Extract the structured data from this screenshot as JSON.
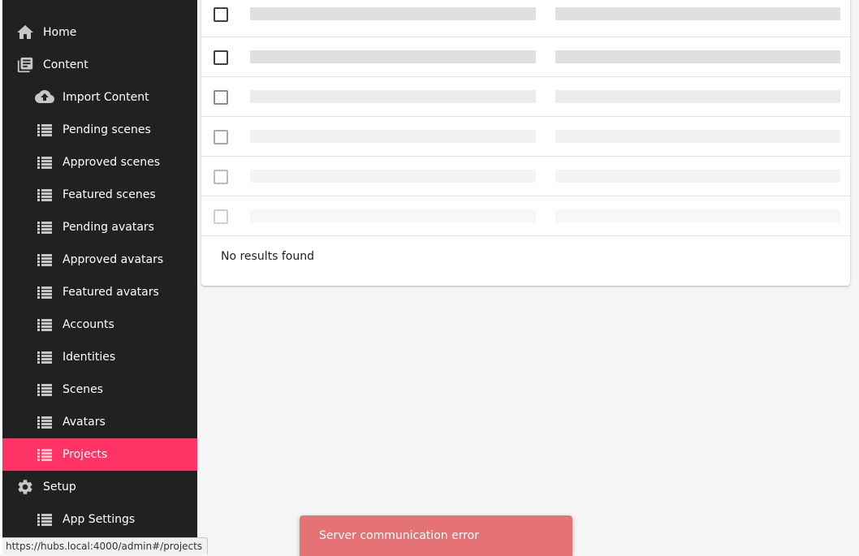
{
  "colors": {
    "sidebar_bg": "#212121",
    "active_bg": "#ff3464",
    "snackbar_bg": "#e57373",
    "skeleton": "#e0e0e0",
    "page_bg": "#f5f5f5"
  },
  "sidebar": {
    "items": [
      {
        "label": "Home",
        "icon": "home-icon",
        "level": "top",
        "active": false
      },
      {
        "label": "Content",
        "icon": "library-books-icon",
        "level": "top",
        "active": false
      },
      {
        "label": "Import Content",
        "icon": "cloud-upload-icon",
        "level": "sub",
        "active": false
      },
      {
        "label": "Pending scenes",
        "icon": "list-icon",
        "level": "sub",
        "active": false
      },
      {
        "label": "Approved scenes",
        "icon": "list-icon",
        "level": "sub",
        "active": false
      },
      {
        "label": "Featured scenes",
        "icon": "list-icon",
        "level": "sub",
        "active": false
      },
      {
        "label": "Pending avatars",
        "icon": "list-icon",
        "level": "sub",
        "active": false
      },
      {
        "label": "Approved avatars",
        "icon": "list-icon",
        "level": "sub",
        "active": false
      },
      {
        "label": "Featured avatars",
        "icon": "list-icon",
        "level": "sub",
        "active": false
      },
      {
        "label": "Accounts",
        "icon": "list-icon",
        "level": "sub",
        "active": false
      },
      {
        "label": "Identities",
        "icon": "list-icon",
        "level": "sub",
        "active": false
      },
      {
        "label": "Scenes",
        "icon": "list-icon",
        "level": "sub",
        "active": false
      },
      {
        "label": "Avatars",
        "icon": "list-icon",
        "level": "sub",
        "active": false
      },
      {
        "label": "Projects",
        "icon": "list-icon",
        "level": "sub",
        "active": true
      },
      {
        "label": "Setup",
        "icon": "gear-icon",
        "level": "top",
        "active": false
      },
      {
        "label": "App Settings",
        "icon": "list-icon",
        "level": "sub",
        "active": false
      }
    ]
  },
  "list": {
    "empty_message": "No results found"
  },
  "snackbar": {
    "message": "Server communication error"
  },
  "status_bar": {
    "url": "https://hubs.local:4000/admin#/projects"
  }
}
